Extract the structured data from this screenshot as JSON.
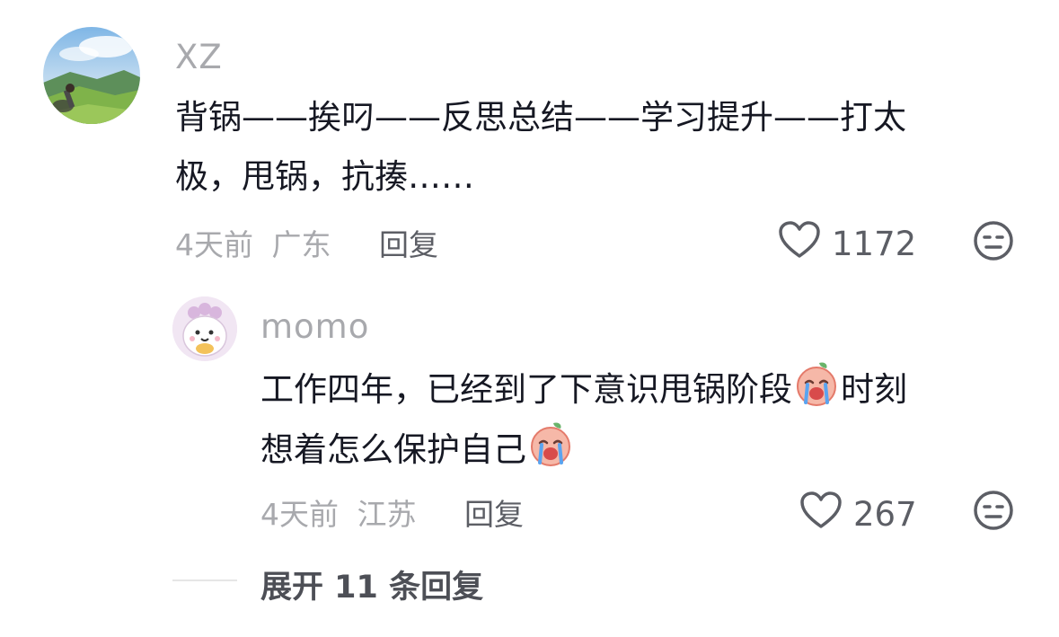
{
  "comment": {
    "username": "XZ",
    "text_line1": "背锅——挨叼——反思总结——学习提升——打太",
    "text_line2": "极，甩锅，抗揍……",
    "time": "4天前",
    "location": "广东",
    "reply_label": "回复",
    "likes": "1172"
  },
  "reply": {
    "username": "momo",
    "text_line1_a": "工作四年，已经到了下意识甩锅阶段",
    "text_line1_b": "时刻",
    "text_line2": "想着怎么保护自己",
    "time": "4天前",
    "location": "江苏",
    "reply_label": "回复",
    "likes": "267"
  },
  "expand": {
    "label": "展开 11 条回复"
  },
  "icons": {
    "like": "heart-outline-icon",
    "reaction": "neutral-face-icon",
    "emoji": "crying-peach-emoji"
  }
}
